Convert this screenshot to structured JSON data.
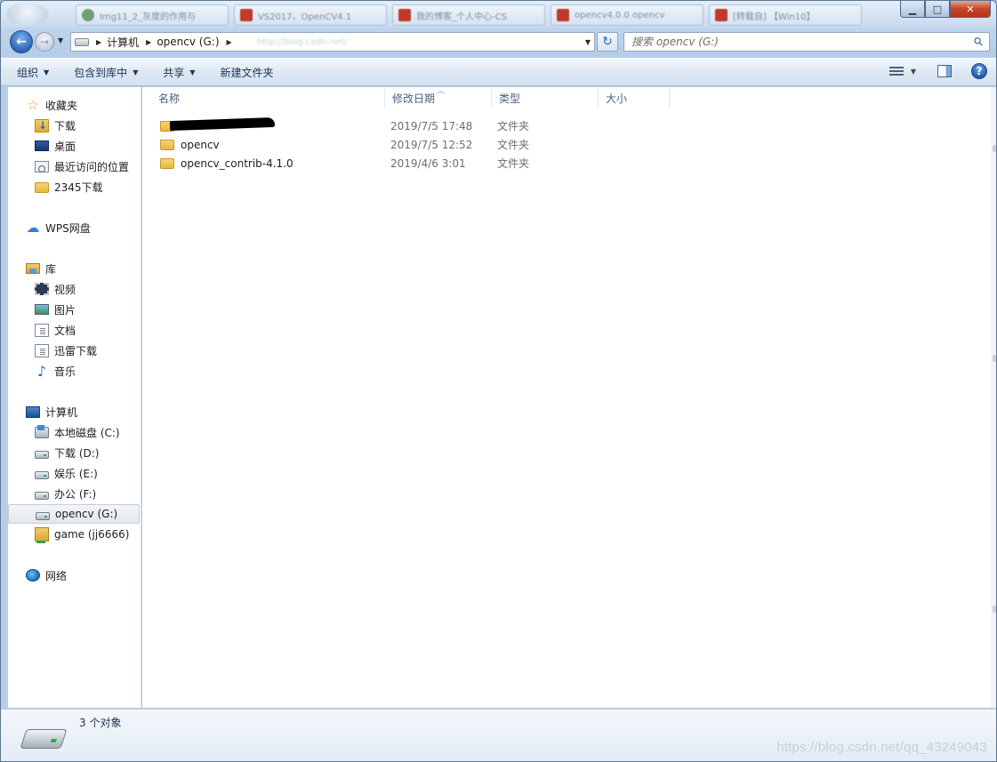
{
  "tabs": [
    {
      "label": "Img11_2_灰度的作用与",
      "icon": "green-circle-icon"
    },
    {
      "label": "VS2017、OpenCV4.1",
      "icon": "csdn-icon"
    },
    {
      "label": "我的博客_个人中心-CS",
      "icon": "csdn-icon"
    },
    {
      "label": "opencv4.0.0 opencv",
      "icon": "csdn-icon"
    },
    {
      "label": "[转载自] 【Win10】",
      "icon": "csdn-icon"
    }
  ],
  "window_controls": {
    "minimize": "▁",
    "maximize": "□",
    "close": "✕"
  },
  "nav": {
    "back": "←",
    "forward": "→",
    "history": "▼"
  },
  "address": {
    "crumbs": [
      "计算机",
      "opencv (G:)"
    ],
    "dropdown": "▼",
    "ghost": "http://blog.csdn.net/"
  },
  "refresh": "↻",
  "search": {
    "placeholder": "搜索 opencv (G:)",
    "icon": "⚲"
  },
  "commands": [
    {
      "label": "组织",
      "caret": "▼"
    },
    {
      "label": "包含到库中",
      "caret": "▼"
    },
    {
      "label": "共享",
      "caret": "▼"
    },
    {
      "label": "新建文件夹",
      "caret": ""
    }
  ],
  "view_caret": "▼",
  "help": "?",
  "sidebar": {
    "favorites": {
      "label": "收藏夹",
      "icon": "☆",
      "items": [
        "下载",
        "桌面",
        "最近访问的位置",
        "2345下载"
      ]
    },
    "wps": {
      "label": "WPS网盘",
      "icon": "☁"
    },
    "libraries": {
      "label": "库",
      "items": [
        "视频",
        "图片",
        "文档",
        "迅雷下载",
        "音乐"
      ]
    },
    "music_icon": "♪",
    "computer": {
      "label": "计算机",
      "items": [
        "本地磁盘 (C:)",
        "下载 (D:)",
        "娱乐 (E:)",
        "办公 (F:)",
        "opencv (G:)",
        "game (jj6666)"
      ]
    },
    "network": {
      "label": "网络"
    }
  },
  "columns": {
    "name": "名称",
    "date": "修改日期",
    "type": "类型",
    "size": "大小",
    "sort_arrow": "︿"
  },
  "files": [
    {
      "name": "",
      "redacted": true,
      "date": "2019/7/5 17:48",
      "type": "文件夹"
    },
    {
      "name": "opencv",
      "redacted": false,
      "date": "2019/7/5 12:52",
      "type": "文件夹"
    },
    {
      "name": "opencv_contrib-4.1.0",
      "redacted": false,
      "date": "2019/4/6 3:01",
      "type": "文件夹"
    }
  ],
  "status": {
    "count": "3 个对象"
  },
  "watermark": "https://blog.csdn.net/qq_43249043"
}
